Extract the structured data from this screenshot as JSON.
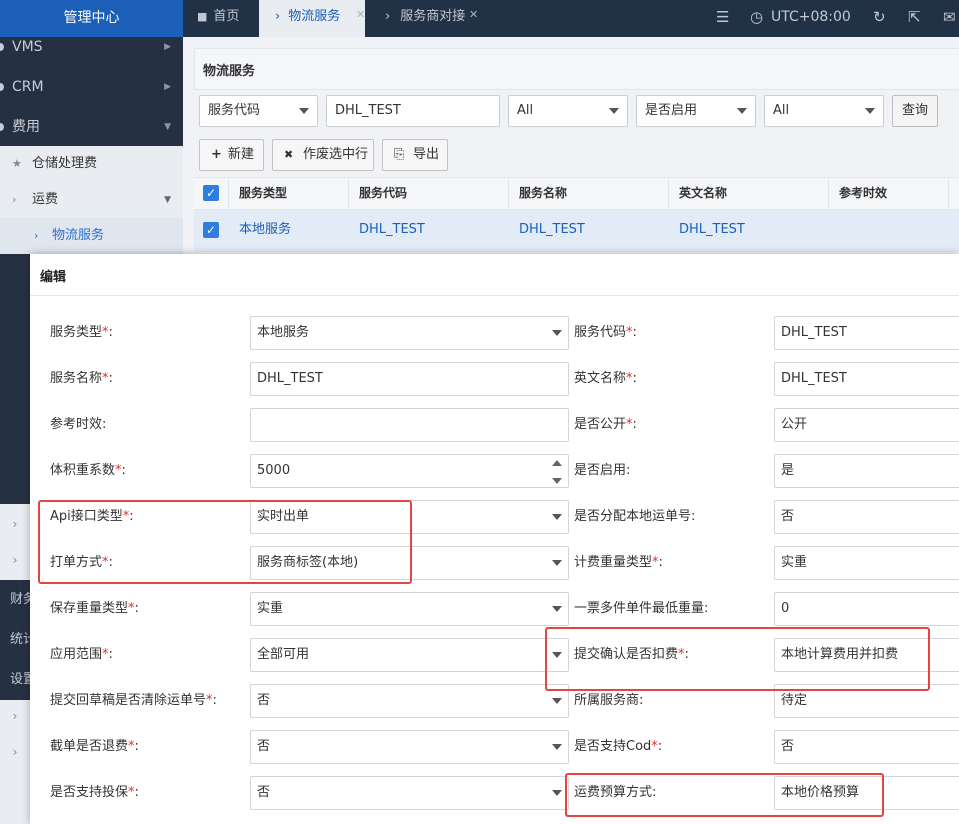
{
  "app": {
    "title": "管理中心"
  },
  "sidebar": {
    "items": [
      {
        "label": "VMS"
      },
      {
        "label": "CRM"
      },
      {
        "label": "费用"
      }
    ],
    "sub": [
      {
        "label": "仓储处理费",
        "icon": "star-icon"
      },
      {
        "label": "运费",
        "icon": "chevron-right-icon"
      },
      {
        "label": "物流服务",
        "icon": "chevron-right-icon"
      }
    ],
    "edge_labels": [
      "财务",
      "统计",
      "设置"
    ]
  },
  "tabs": {
    "home": "首页",
    "active": "物流服务",
    "other": "服务商对接"
  },
  "topbar": {
    "timezone": "UTC+08:00"
  },
  "panel": {
    "title": "物流服务",
    "filters": {
      "field_select": "服务代码",
      "field_value": "DHL_TEST",
      "type_select": "All",
      "enabled_select": "是否启用",
      "status_select": "All",
      "query_label": "查询"
    },
    "actions": {
      "new_label": "新建",
      "void_label": "作废选中行",
      "export_label": "导出"
    },
    "table": {
      "columns": [
        "服务类型",
        "服务代码",
        "服务名称",
        "英文名称",
        "参考时效"
      ],
      "row": [
        "本地服务",
        "DHL_TEST",
        "DHL_TEST",
        "DHL_TEST",
        ""
      ]
    }
  },
  "modal": {
    "title": "编辑",
    "left": [
      {
        "label": "服务类型",
        "required": true,
        "value": "本地服务",
        "type": "select"
      },
      {
        "label": "服务名称",
        "required": true,
        "value": "DHL_TEST",
        "type": "input"
      },
      {
        "label": "参考时效",
        "required": false,
        "value": "",
        "type": "input"
      },
      {
        "label": "体积重系数",
        "required": true,
        "value": "5000",
        "type": "number"
      },
      {
        "label": "Api接口类型",
        "required": true,
        "value": "实时出单",
        "type": "select"
      },
      {
        "label": "打单方式",
        "required": true,
        "value": "服务商标签(本地)",
        "type": "select"
      },
      {
        "label": "保存重量类型",
        "required": true,
        "value": "实重",
        "type": "select"
      },
      {
        "label": "应用范围",
        "required": true,
        "value": "全部可用",
        "type": "select"
      },
      {
        "label": "提交回草稿是否清除运单号",
        "required": true,
        "value": "否",
        "type": "select"
      },
      {
        "label": "截单是否退费",
        "required": true,
        "value": "否",
        "type": "select"
      },
      {
        "label": "是否支持投保",
        "required": true,
        "value": "否",
        "type": "select"
      }
    ],
    "right": [
      {
        "label": "服务代码",
        "required": true,
        "value": "DHL_TEST"
      },
      {
        "label": "英文名称",
        "required": true,
        "value": "DHL_TEST"
      },
      {
        "label": "是否公开",
        "required": true,
        "value": "公开"
      },
      {
        "label": "是否启用",
        "required": false,
        "value": "是"
      },
      {
        "label": "是否分配本地运单号",
        "required": false,
        "value": "否"
      },
      {
        "label": "计费重量类型",
        "required": true,
        "value": "实重"
      },
      {
        "label": "一票多件单件最低重量",
        "required": false,
        "value": "0"
      },
      {
        "label": "提交确认是否扣费",
        "required": true,
        "value": "本地计算费用并扣费"
      },
      {
        "label": "所属服务商",
        "required": false,
        "value": "待定"
      },
      {
        "label": "是否支持Cod",
        "required": true,
        "value": "否"
      },
      {
        "label": "运费预算方式",
        "required": false,
        "value": "本地价格预算"
      }
    ]
  },
  "colors": {
    "accent": "#1b5fb8",
    "highlight": "#e34444",
    "required": "#e23030"
  }
}
